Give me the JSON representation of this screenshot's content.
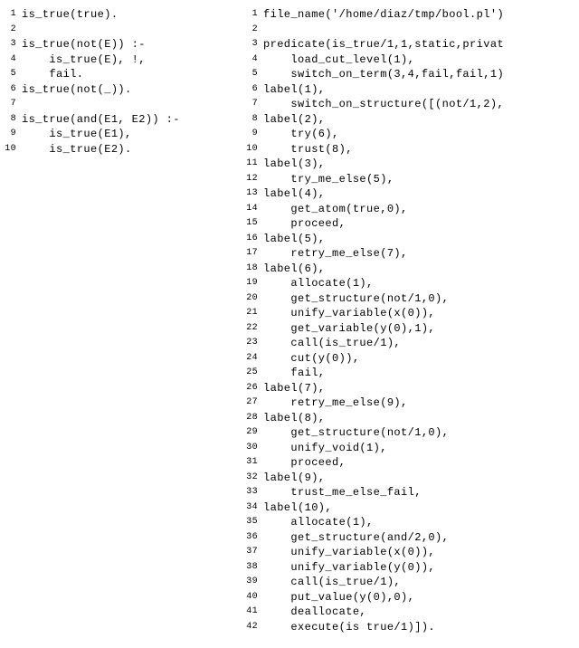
{
  "left": [
    {
      "n": "1",
      "t": "is_true(true)."
    },
    {
      "n": "2",
      "t": ""
    },
    {
      "n": "3",
      "t": "is_true(not(E)) :-"
    },
    {
      "n": "4",
      "t": "    is_true(E), !,"
    },
    {
      "n": "5",
      "t": "    fail."
    },
    {
      "n": "6",
      "t": "is_true(not(_))."
    },
    {
      "n": "7",
      "t": ""
    },
    {
      "n": "8",
      "t": "is_true(and(E1, E2)) :-"
    },
    {
      "n": "9",
      "t": "    is_true(E1),"
    },
    {
      "n": "10",
      "t": "    is_true(E2)."
    }
  ],
  "right": [
    {
      "n": "1",
      "t": "file_name('/home/diaz/tmp/bool.pl')"
    },
    {
      "n": "2",
      "t": ""
    },
    {
      "n": "3",
      "t": "predicate(is_true/1,1,static,privat"
    },
    {
      "n": "4",
      "t": "    load_cut_level(1),"
    },
    {
      "n": "5",
      "t": "    switch_on_term(3,4,fail,fail,1)"
    },
    {
      "n": "6",
      "t": "label(1),"
    },
    {
      "n": "7",
      "t": "    switch_on_structure([(not/1,2),"
    },
    {
      "n": "8",
      "t": "label(2),"
    },
    {
      "n": "9",
      "t": "    try(6),"
    },
    {
      "n": "10",
      "t": "    trust(8),"
    },
    {
      "n": "11",
      "t": "label(3),"
    },
    {
      "n": "12",
      "t": "    try_me_else(5),"
    },
    {
      "n": "13",
      "t": "label(4),"
    },
    {
      "n": "14",
      "t": "    get_atom(true,0),"
    },
    {
      "n": "15",
      "t": "    proceed,"
    },
    {
      "n": "16",
      "t": "label(5),"
    },
    {
      "n": "17",
      "t": "    retry_me_else(7),"
    },
    {
      "n": "18",
      "t": "label(6),"
    },
    {
      "n": "19",
      "t": "    allocate(1),"
    },
    {
      "n": "20",
      "t": "    get_structure(not/1,0),"
    },
    {
      "n": "21",
      "t": "    unify_variable(x(0)),"
    },
    {
      "n": "22",
      "t": "    get_variable(y(0),1),"
    },
    {
      "n": "23",
      "t": "    call(is_true/1),"
    },
    {
      "n": "24",
      "t": "    cut(y(0)),"
    },
    {
      "n": "25",
      "t": "    fail,"
    },
    {
      "n": "26",
      "t": "label(7),"
    },
    {
      "n": "27",
      "t": "    retry_me_else(9),"
    },
    {
      "n": "28",
      "t": "label(8),"
    },
    {
      "n": "29",
      "t": "    get_structure(not/1,0),"
    },
    {
      "n": "30",
      "t": "    unify_void(1),"
    },
    {
      "n": "31",
      "t": "    proceed,"
    },
    {
      "n": "32",
      "t": "label(9),"
    },
    {
      "n": "33",
      "t": "    trust_me_else_fail,"
    },
    {
      "n": "34",
      "t": "label(10),"
    },
    {
      "n": "35",
      "t": "    allocate(1),"
    },
    {
      "n": "36",
      "t": "    get_structure(and/2,0),"
    },
    {
      "n": "37",
      "t": "    unify_variable(x(0)),"
    },
    {
      "n": "38",
      "t": "    unify_variable(y(0)),"
    },
    {
      "n": "39",
      "t": "    call(is_true/1),"
    },
    {
      "n": "40",
      "t": "    put_value(y(0),0),"
    },
    {
      "n": "41",
      "t": "    deallocate,"
    },
    {
      "n": "42",
      "t": "    execute(is true/1)])."
    }
  ]
}
